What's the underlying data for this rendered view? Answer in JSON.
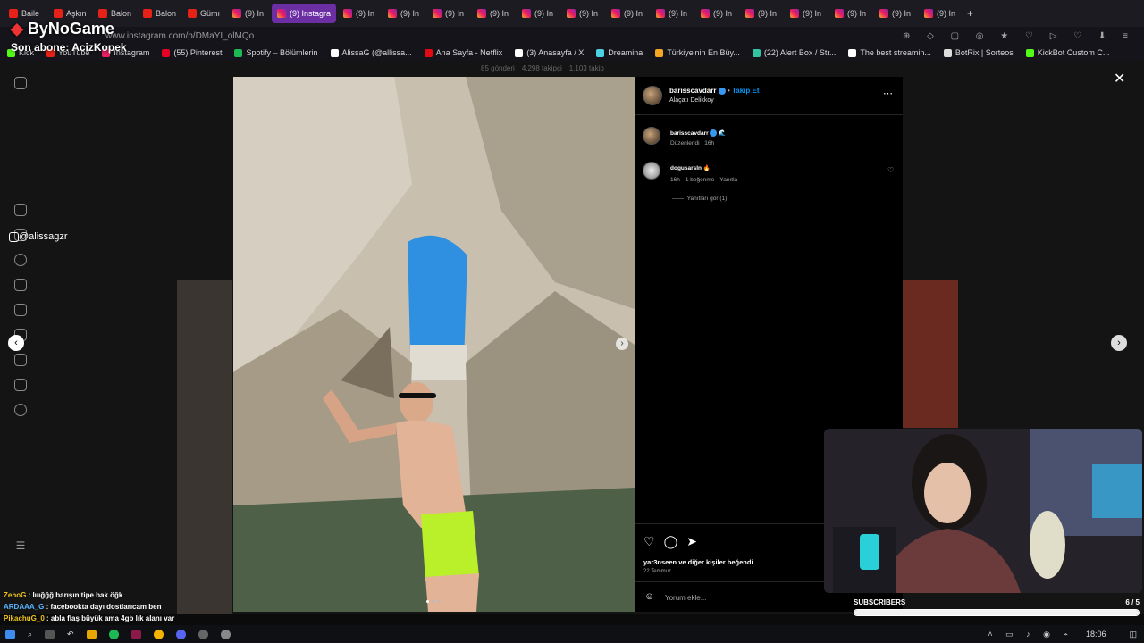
{
  "browser": {
    "tabs": [
      {
        "label": "Baile",
        "type": "yt"
      },
      {
        "label": "Aşkın",
        "type": "yt"
      },
      {
        "label": "Balon",
        "type": "yt"
      },
      {
        "label": "Balon",
        "type": "yt"
      },
      {
        "label": "Gümı",
        "type": "yt"
      },
      {
        "label": "(9) In",
        "type": "ig"
      },
      {
        "label": "(9) Instagra",
        "type": "ig",
        "active": true
      },
      {
        "label": "(9) In",
        "type": "ig"
      },
      {
        "label": "(9) In",
        "type": "ig"
      },
      {
        "label": "(9) In",
        "type": "ig"
      },
      {
        "label": "(9) In",
        "type": "ig"
      },
      {
        "label": "(9) In",
        "type": "ig"
      },
      {
        "label": "(9) In",
        "type": "ig"
      },
      {
        "label": "(9) In",
        "type": "ig"
      },
      {
        "label": "(9) In",
        "type": "ig"
      },
      {
        "label": "(9) In",
        "type": "ig"
      },
      {
        "label": "(9) In",
        "type": "ig"
      },
      {
        "label": "(9) In",
        "type": "ig"
      },
      {
        "label": "(9) In",
        "type": "ig"
      },
      {
        "label": "(9) In",
        "type": "ig"
      },
      {
        "label": "(9) In",
        "type": "ig"
      }
    ],
    "url": "www.instagram.com/p/DMaYI_olMQo",
    "bookmarks": [
      {
        "label": "Kick",
        "color": "#53fc18"
      },
      {
        "label": "YouTube",
        "color": "#e62117"
      },
      {
        "label": "Instagram",
        "color": "#e91e63"
      },
      {
        "label": "(55) Pinterest",
        "color": "#e60023"
      },
      {
        "label": "Spotify – Bölümlerin",
        "color": "#1db954"
      },
      {
        "label": "AlissaG (@allissa...",
        "color": "#ffffff"
      },
      {
        "label": "Ana Sayfa - Netflix",
        "color": "#e50914"
      },
      {
        "label": "(3) Anasayfa / X",
        "color": "#ffffff"
      },
      {
        "label": "Dreamina",
        "color": "#4dd0e1"
      },
      {
        "label": "Türkiye'nin En Büy...",
        "color": "#f5a623"
      },
      {
        "label": "(22) Alert Box / Str...",
        "color": "#31c3a2"
      },
      {
        "label": "The best streamin...",
        "color": "#ffffff"
      },
      {
        "label": "BotRix | Sorteos",
        "color": "#dddddd"
      },
      {
        "label": "KickBot Custom C...",
        "color": "#53fc18"
      }
    ]
  },
  "overlay": {
    "brand": "ByNoGame",
    "last_sub": "Son abone: AcizKopek",
    "handle": "@alissagzr",
    "subs_label": "SUBSCRIBERS",
    "subs_count": "6 / 5",
    "subs_progress": 1.0
  },
  "profile_strip": {
    "posts": "85 gönderi",
    "followers": "4.298 takipçi",
    "following": "1.103 takip"
  },
  "post": {
    "username": "barisscavdarr",
    "follow": "Takip Et",
    "location": "Alaçatı Delikkoy",
    "caption_user": "barisscavdarr",
    "caption_meta": "Düzenlendi · 16h",
    "comment_user": "dogusarsln",
    "comment_time": "16h",
    "comment_likes": "1 beğenme",
    "comment_reply": "Yanıtla",
    "view_replies": "Yanıtları gör (1)",
    "liked_by": "yar3nseen ve diğer kişiler beğendi",
    "date": "22 Temmuz",
    "add_comment": "Yorum ekle..."
  },
  "chat": [
    {
      "user": "ZehoG",
      "msg": "lııığğğ barışın tipe bak öğk",
      "color": "#f0c419"
    },
    {
      "user": "ARDAAA_G",
      "msg": "facebookta dayı dostlarıcam ben",
      "color": "#5ab4ff"
    },
    {
      "user": "PikachuG_0",
      "msg": "abla flaş büyük ama 4gb lık alanı var",
      "color": "#f0c419"
    }
  ],
  "taskbar": {
    "time": "18:06"
  }
}
